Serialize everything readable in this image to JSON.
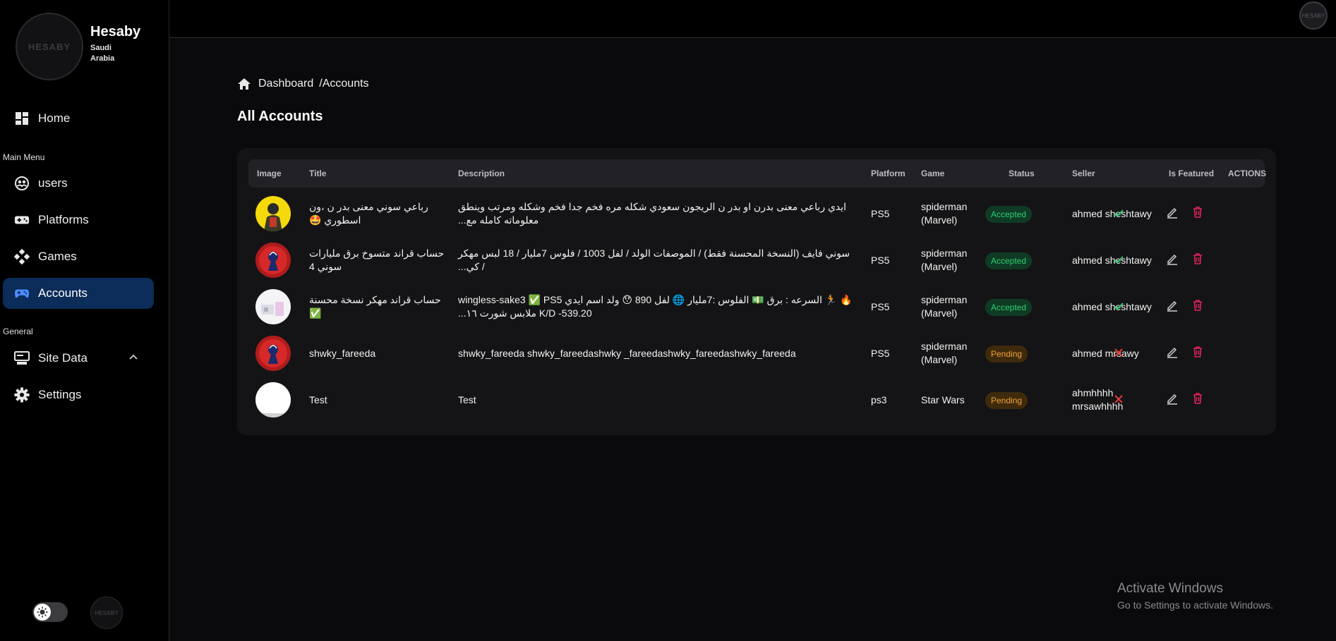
{
  "brand": {
    "name": "Hesaby",
    "subtitle": "Saudi Arabia",
    "logo_text": "HESABY"
  },
  "sidebar": {
    "home": {
      "label": "Home",
      "icon": "dashboard-icon"
    },
    "main_menu_label": "Main Menu",
    "items": [
      {
        "label": "users",
        "icon": "users-icon"
      },
      {
        "label": "Platforms",
        "icon": "gamepad-icon"
      },
      {
        "label": "Games",
        "icon": "puzzle-icon"
      },
      {
        "label": "Accounts",
        "icon": "controller-icon",
        "active": true
      }
    ],
    "general_label": "General",
    "general_items": [
      {
        "label": "Site Data",
        "icon": "server-icon",
        "expanded": true
      },
      {
        "label": "Settings",
        "icon": "gear-icon"
      }
    ]
  },
  "breadcrumb": {
    "home": "Dashboard",
    "current": "/Accounts"
  },
  "page": {
    "title": "All Accounts"
  },
  "table": {
    "columns": [
      "Image",
      "Title",
      "Description",
      "Platform",
      "Game",
      "Status",
      "Seller",
      "Is Featured",
      "ACTIONS"
    ],
    "rows": [
      {
        "title": "رباعي سوني معنى بدر ن ،ون اسطوري 🤩",
        "description": "ايدي رباعي معنى بدرن او بدر ن الريجون سعودي شكله مره فخم جدا فخم وشكله ومرتب وينطق معلوماته كامله مع...",
        "platform": "PS5",
        "game": "spiderman (Marvel)",
        "status": "Accepted",
        "seller": "ahmed sheshtawy",
        "featured": true
      },
      {
        "title": "حساب قراند متسوخ برق مليارات سوني 4",
        "description": "سوني فايف (النسخة المحسنة فقط) / الموصفات الولد / لفل 1003 / فلوس 7مليار / 18 لبس مهكر / كي...",
        "platform": "PS5",
        "game": "spiderman (Marvel)",
        "status": "Accepted",
        "seller": "ahmed sheshtawy",
        "featured": true
      },
      {
        "title": "حساب قراند مهكر نسخة محسنة ✅",
        "description": "🔥 🏃 السرعه : برق 💵 الفلوس :7مليار 🌐 لفل 890 😯 ولد اسم ايدي wingless-sake3 ✅ PS5 K/D -539.20 ملابس شورت ١٦...",
        "platform": "PS5",
        "game": "spiderman (Marvel)",
        "status": "Accepted",
        "seller": "ahmed sheshtawy",
        "featured": true
      },
      {
        "title": "shwky_fareeda",
        "description": "shwky_fareeda shwky_fareedashwky _fareedashwky_fareedashwky_fareeda",
        "platform": "PS5",
        "game": "spiderman (Marvel)",
        "status": "Pending",
        "seller": "ahmed mrsawy",
        "featured": false
      },
      {
        "title": "Test",
        "description": "Test",
        "platform": "ps3",
        "game": "Star Wars",
        "status": "Pending",
        "seller": "ahmhhhh mrsawhhhh",
        "featured": false
      }
    ]
  },
  "colors": {
    "accent": "#0c2c59",
    "accepted": "#2fcf6f",
    "pending": "#f0a43a",
    "delete": "#e0245e",
    "not_featured": "#e53935"
  },
  "watermark": {
    "title": "Activate Windows",
    "subtitle": "Go to Settings to activate Windows."
  }
}
